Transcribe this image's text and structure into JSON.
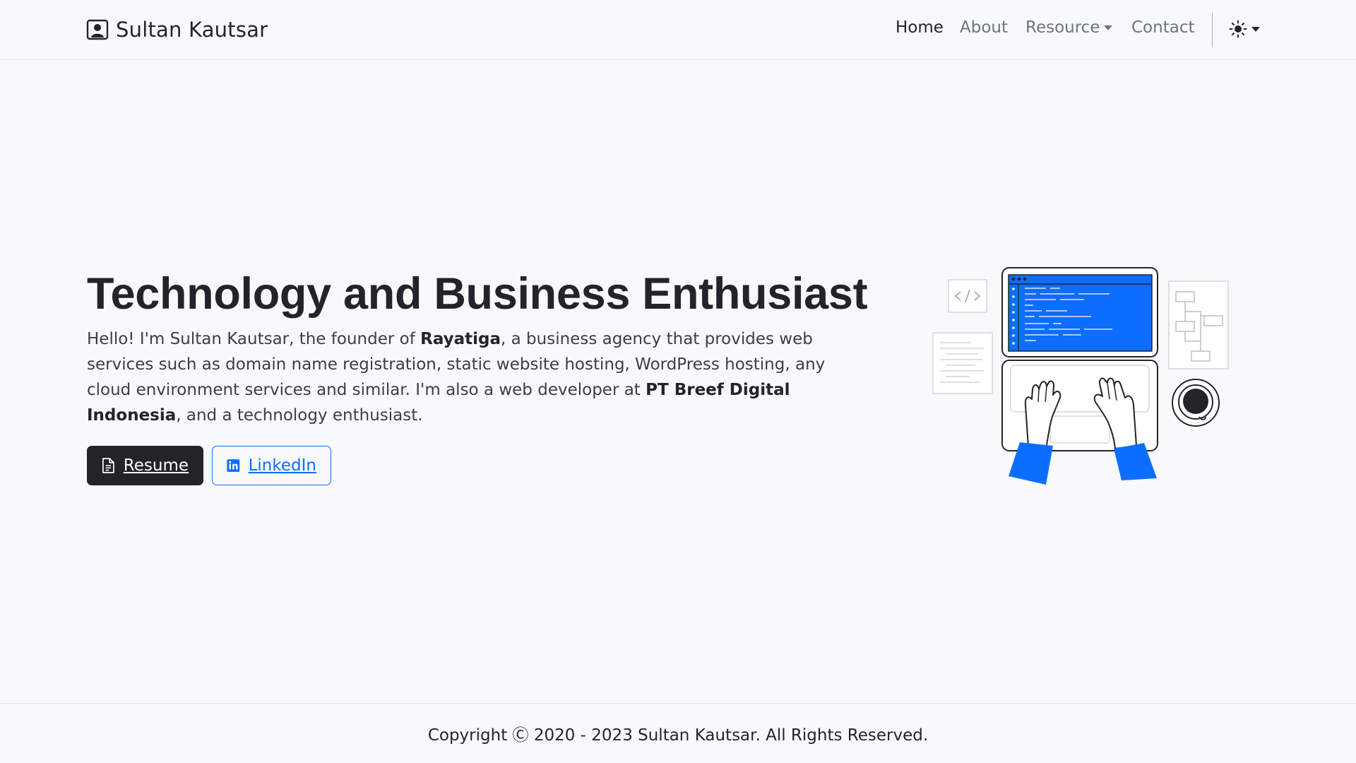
{
  "brand": {
    "name": "Sultan Kautsar",
    "icon": "person-badge-icon"
  },
  "nav": {
    "home": "Home",
    "about": "About",
    "resource": "Resource",
    "contact": "Contact",
    "theme_icon": "sun-icon"
  },
  "hero": {
    "title": "Technology and Business Enthusiast",
    "intro_1": "Hello! I'm Sultan Kautsar, the founder of ",
    "company_1": "Rayatiga",
    "intro_2": ", a business agency that provides web services such as domain name registration, static website hosting, WordPress hosting, any cloud environment services and similar. I'm also a web developer at ",
    "company_2": "PT Breef Digital Indonesia",
    "intro_3": ", and a technology enthusiast.",
    "resume_label": "Resume",
    "resume_icon": "file-text-icon",
    "linkedin_label": "LinkedIn",
    "linkedin_icon": "linkedin-icon"
  },
  "footer": {
    "copyright": "Copyright Ⓒ 2020 - 2023 Sultan Kautsar. All Rights Reserved."
  },
  "colors": {
    "background": "#f8f9fa",
    "text": "#212529",
    "muted": "#6c757d",
    "primary": "#0d6efd",
    "dark_button": "#212529"
  }
}
